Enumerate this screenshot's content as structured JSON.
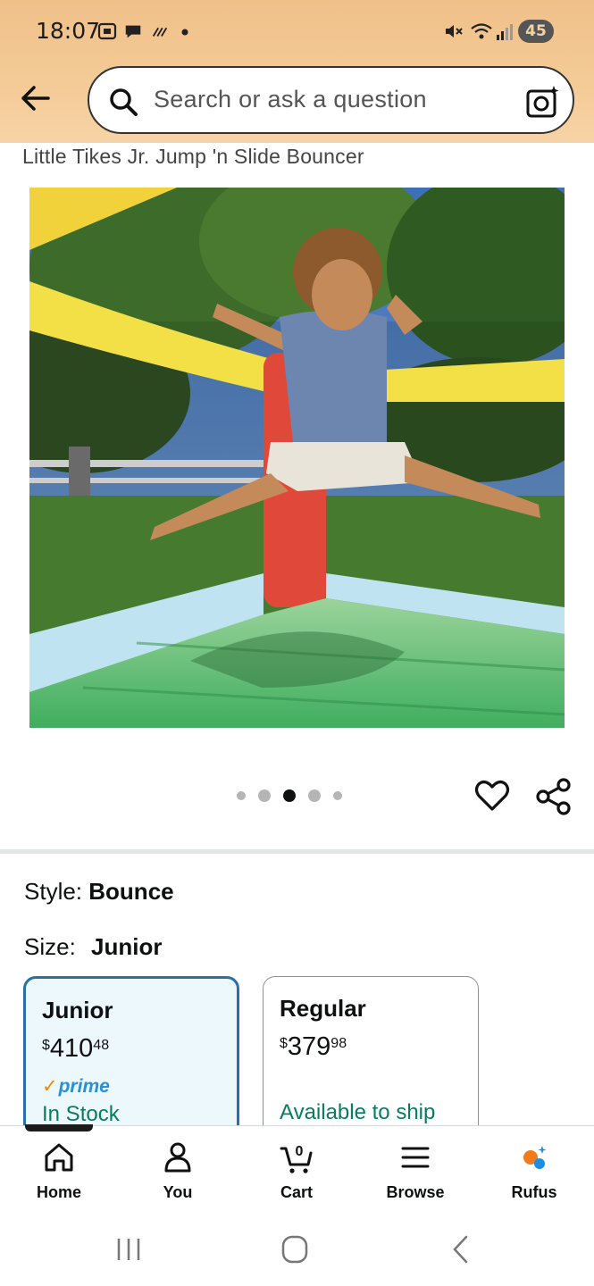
{
  "status_bar": {
    "time": "18:07",
    "battery": "45"
  },
  "search": {
    "placeholder": "Search or ask a question"
  },
  "product": {
    "title": "Little Tikes Jr. Jump 'n Slide Bouncer",
    "image_count": 5,
    "active_image_index": 2
  },
  "variants": {
    "style_label": "Style:",
    "style_value": "Bounce",
    "size_label": "Size:",
    "size_value": "Junior",
    "options": [
      {
        "name": "Junior",
        "currency": "$",
        "price_whole": "410",
        "price_fraction": "48",
        "prime": "prime",
        "availability": "In Stock",
        "selected": true
      },
      {
        "name": "Regular",
        "currency": "$",
        "price_whole": "379",
        "price_fraction": "98",
        "availability": "Available to ship",
        "selected": false
      }
    ]
  },
  "bottom_nav": {
    "items": [
      {
        "label": "Home",
        "icon": "home-icon"
      },
      {
        "label": "You",
        "icon": "person-icon"
      },
      {
        "label": "Cart",
        "icon": "cart-icon",
        "count": "0"
      },
      {
        "label": "Browse",
        "icon": "menu-icon"
      },
      {
        "label": "Rufus",
        "icon": "rufus-icon"
      }
    ]
  },
  "colors": {
    "header_bg": "#f3c995",
    "selected_border": "#2a6fa8",
    "selected_bg": "#edf8fd",
    "stock_green": "#067d62",
    "prime_blue": "#2a8fd6",
    "prime_check": "#f08804",
    "rufus_orange": "#f27a1a"
  }
}
